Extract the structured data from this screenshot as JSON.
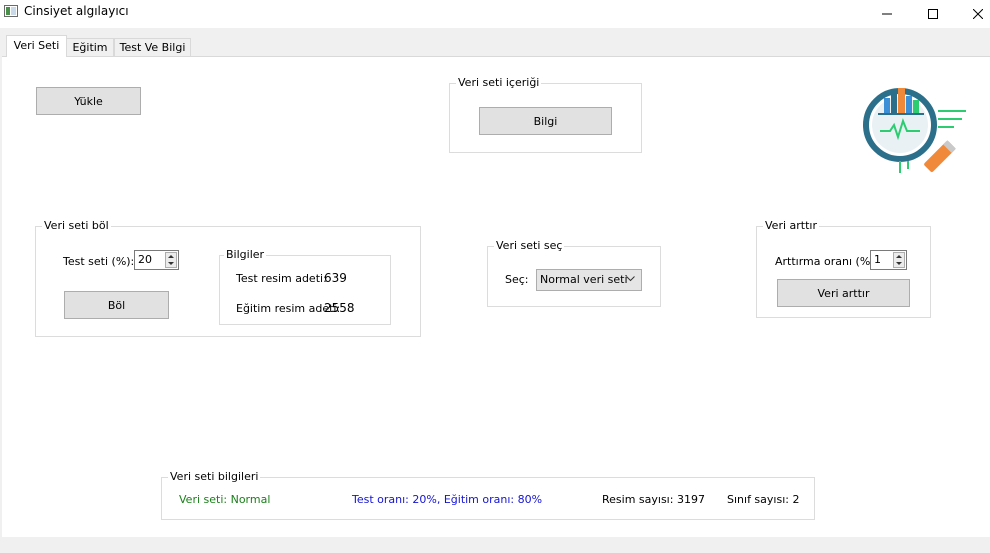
{
  "window": {
    "title": "Cinsiyet algılayıcı",
    "controls": {
      "minimize": "minimize-icon",
      "maximize": "maximize-icon",
      "close": "close-icon"
    }
  },
  "tabs": [
    {
      "label": "Veri Seti",
      "active": true
    },
    {
      "label": "Eğitim",
      "active": false
    },
    {
      "label": "Test Ve Bilgi",
      "active": false
    }
  ],
  "load_button": "Yükle",
  "content_group": {
    "title": "Veri seti içeriği",
    "info_button": "Bilgi"
  },
  "split_group": {
    "title": "Veri seti böl",
    "test_label": "Test seti (%):",
    "test_value": "20",
    "split_button": "Böl",
    "info": {
      "title": "Bilgiler",
      "test_count_label": "Test resim adeti:",
      "test_count": "639",
      "train_count_label": "Eğitim resim adeti:",
      "train_count": "2558"
    }
  },
  "select_group": {
    "title": "Veri seti seç",
    "label": "Seç:",
    "selected": "Normal veri seti"
  },
  "augment_group": {
    "title": "Veri arttır",
    "rate_label": "Arttırma oranı (%):",
    "rate_value": "1",
    "augment_button": "Veri arttır"
  },
  "dataset_info": {
    "title": "Veri seti bilgileri",
    "dataset": "Veri seti: Normal",
    "ratios": "Test oranı: 20%, Eğitim oranı: 80%",
    "image_count": "Resim sayısı: 3197",
    "class_count": "Sınıf sayısı: 2"
  },
  "colors": {
    "dataset_text": "#1a7f1a",
    "ratio_text": "#1414d6",
    "logo_ring": "#2b6f8a",
    "logo_handle": "#f08a3a",
    "logo_accent": "#2ecc71"
  },
  "logo": {
    "icon": "data-analysis-magnifier-icon"
  }
}
